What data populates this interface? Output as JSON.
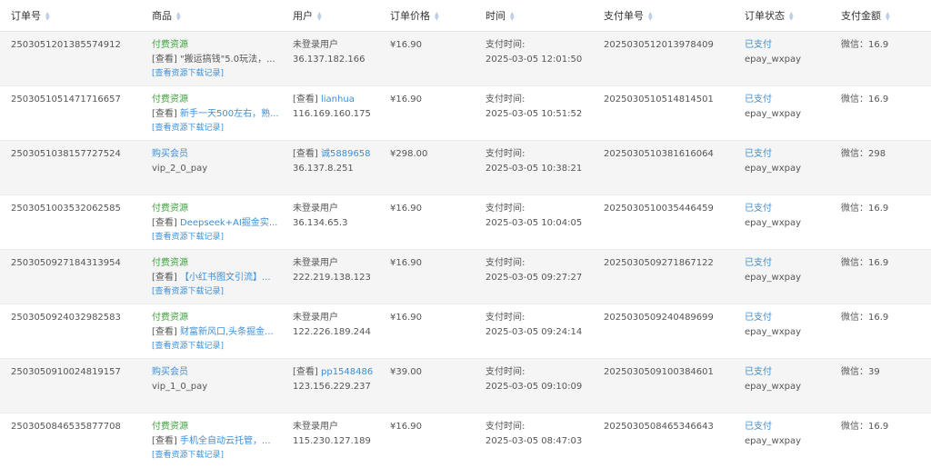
{
  "table": {
    "headers": [
      "订单号",
      "商品",
      "用户",
      "订单价格",
      "时间",
      "支付单号",
      "订单状态",
      "支付金额"
    ],
    "rows": [
      {
        "order_no": "2503051201385574912",
        "goods_type": "付费资源",
        "goods_prefix": "[查看]",
        "goods_name": "\"搬运搞钱\"5.0玩法，...",
        "goods_records": "[查看资源下载记录]",
        "user_prefix": "",
        "user_name": "未登录用户",
        "user_ip": "36.137.182.166",
        "price": "¥16.90",
        "time_label": "支付时间:",
        "time_value": "2025-03-05 12:01:50",
        "pay_no": "2025030512013978409",
        "status": "已支付",
        "pay_method": "epay_wxpay",
        "amount": "微信：16.9"
      },
      {
        "order_no": "2503051051471716657",
        "goods_type": "付费资源",
        "goods_prefix": "[查看]",
        "goods_name": "新手一天500左右，熟...",
        "goods_records": "[查看资源下载记录]",
        "user_prefix": "[查看]",
        "user_name": "lianhua",
        "user_ip": "116.169.160.175",
        "price": "¥16.90",
        "time_label": "支付时间:",
        "time_value": "2025-03-05 10:51:52",
        "pay_no": "2025030510514814501",
        "status": "已支付",
        "pay_method": "epay_wxpay",
        "amount": "微信：16.9"
      },
      {
        "order_no": "2503051038157727524",
        "goods_type": "购买会员",
        "goods_prefix": "",
        "goods_name": "vip_2_0_pay",
        "goods_records": "",
        "user_prefix": "[查看]",
        "user_name": "诚5889658",
        "user_ip": "36.137.8.251",
        "price": "¥298.00",
        "time_label": "支付时间:",
        "time_value": "2025-03-05 10:38:21",
        "pay_no": "2025030510381616064",
        "status": "已支付",
        "pay_method": "epay_wxpay",
        "amount": "微信：298"
      },
      {
        "order_no": "2503051003532062585",
        "goods_type": "付费资源",
        "goods_prefix": "[查看]",
        "goods_name": "Deepseek+AI掘金实...",
        "goods_records": "[查看资源下载记录]",
        "user_prefix": "",
        "user_name": "未登录用户",
        "user_ip": "36.134.65.3",
        "price": "¥16.90",
        "time_label": "支付时间:",
        "time_value": "2025-03-05 10:04:05",
        "pay_no": "2025030510035446459",
        "status": "已支付",
        "pay_method": "epay_wxpay",
        "amount": "微信：16.9"
      },
      {
        "order_no": "2503050927184313954",
        "goods_type": "付费资源",
        "goods_prefix": "[查看]",
        "goods_name": "【小红书图文引流】...",
        "goods_records": "[查看资源下载记录]",
        "user_prefix": "",
        "user_name": "未登录用户",
        "user_ip": "222.219.138.123",
        "price": "¥16.90",
        "time_label": "支付时间:",
        "time_value": "2025-03-05 09:27:27",
        "pay_no": "2025030509271867122",
        "status": "已支付",
        "pay_method": "epay_wxpay",
        "amount": "微信：16.9"
      },
      {
        "order_no": "2503050924032982583",
        "goods_type": "付费资源",
        "goods_prefix": "[查看]",
        "goods_name": "财富新风口,头条掘金...",
        "goods_records": "[查看资源下载记录]",
        "user_prefix": "",
        "user_name": "未登录用户",
        "user_ip": "122.226.189.244",
        "price": "¥16.90",
        "time_label": "支付时间:",
        "time_value": "2025-03-05 09:24:14",
        "pay_no": "2025030509240489699",
        "status": "已支付",
        "pay_method": "epay_wxpay",
        "amount": "微信：16.9"
      },
      {
        "order_no": "2503050910024819157",
        "goods_type": "购买会员",
        "goods_prefix": "",
        "goods_name": "vip_1_0_pay",
        "goods_records": "",
        "user_prefix": "[查看]",
        "user_name": "pp1548486",
        "user_ip": "123.156.229.237",
        "price": "¥39.00",
        "time_label": "支付时间:",
        "time_value": "2025-03-05 09:10:09",
        "pay_no": "2025030509100384601",
        "status": "已支付",
        "pay_method": "epay_wxpay",
        "amount": "微信：39"
      },
      {
        "order_no": "2503050846535877708",
        "goods_type": "付费资源",
        "goods_prefix": "[查看]",
        "goods_name": "手机全自动云托管，...",
        "goods_records": "[查看资源下载记录]",
        "user_prefix": "",
        "user_name": "未登录用户",
        "user_ip": "115.230.127.189",
        "price": "¥16.90",
        "time_label": "支付时间:",
        "time_value": "2025-03-05 08:47:03",
        "pay_no": "2025030508465346643",
        "status": "已支付",
        "pay_method": "epay_wxpay",
        "amount": "微信：16.9"
      }
    ]
  }
}
